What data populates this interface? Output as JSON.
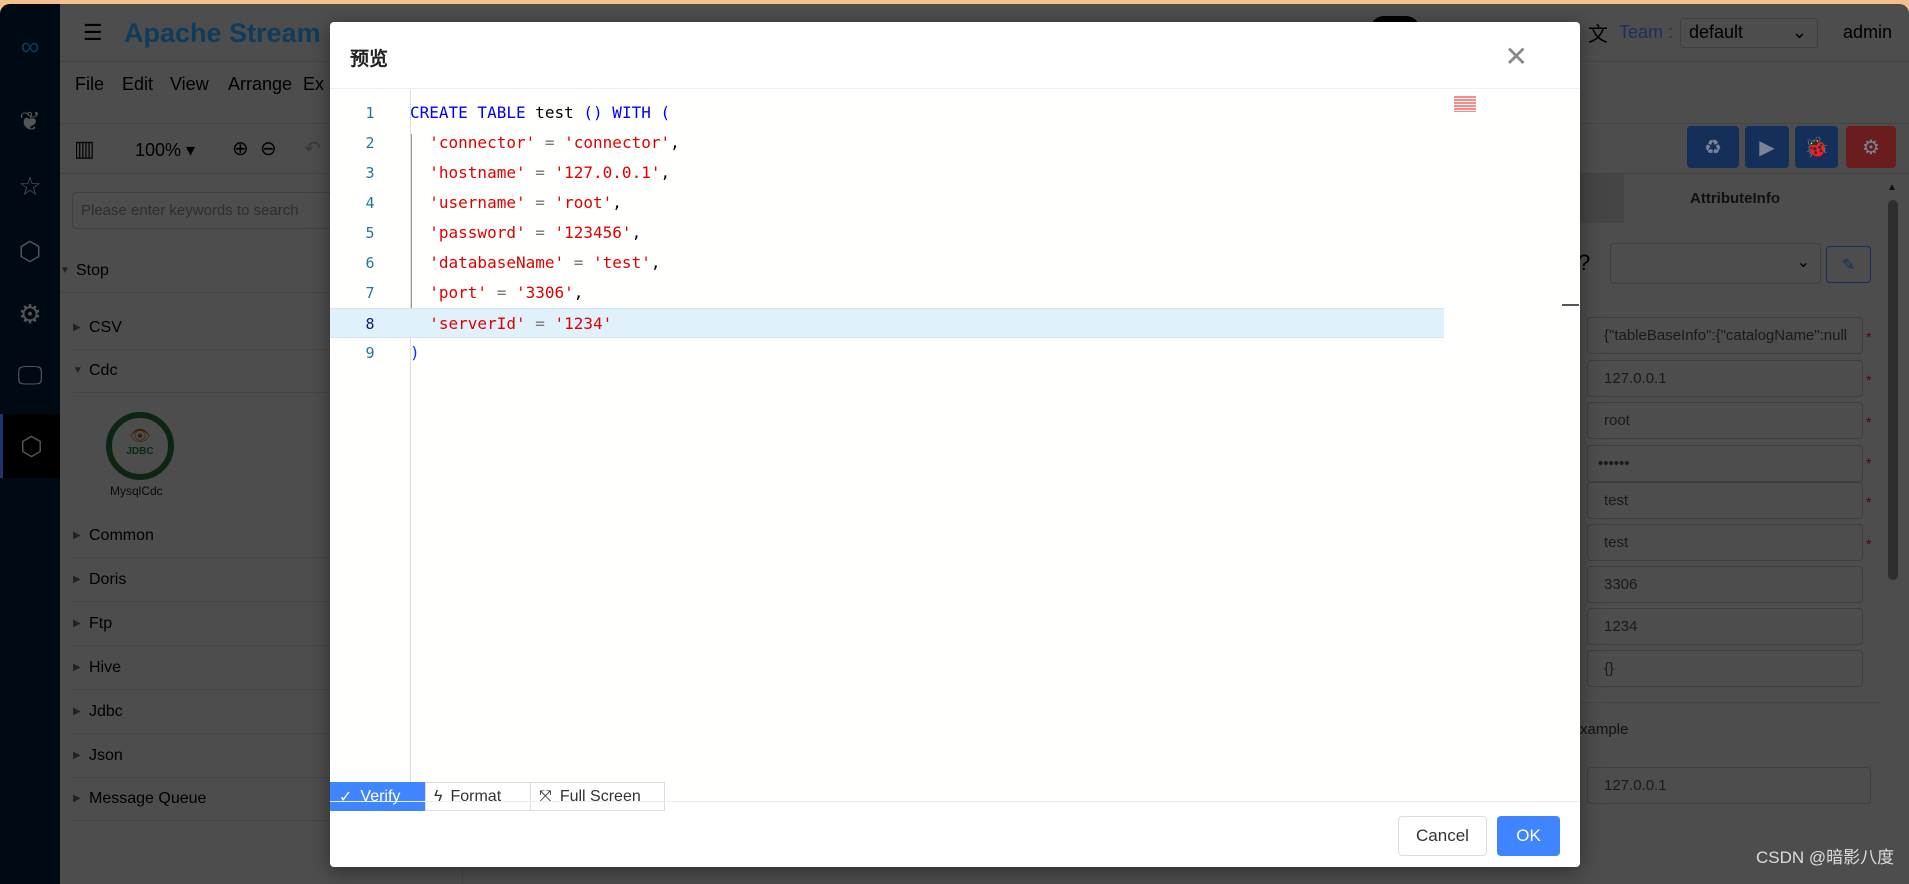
{
  "app": {
    "title": "Apache Stream",
    "team_label": "Team :",
    "team_value": "default",
    "user": "admin"
  },
  "nav": {
    "icons": [
      "logo-icon",
      "squirrel-icon",
      "star-icon",
      "cubes-icon",
      "gear-icon",
      "monitor-icon",
      "cubes-active-icon"
    ]
  },
  "menu": [
    "File",
    "Edit",
    "View",
    "Arrange",
    "Ex"
  ],
  "toolbar": {
    "zoom": "100%"
  },
  "sidebar": {
    "search_placeholder": "Please enter keywords to search",
    "groups": [
      "Stop",
      "CSV",
      "Cdc",
      "Common",
      "Doris",
      "Ftp",
      "Hive",
      "Jdbc",
      "Json",
      "Message Queue"
    ],
    "component": {
      "label": "MysqlCdc",
      "badge": "JDBC"
    }
  },
  "right": {
    "tab": "AttributeInfo",
    "fields": [
      "{\"tableBaseInfo\":{\"catalogName\":null",
      "127.0.0.1",
      "root",
      "••••••",
      "test",
      "test",
      "3306",
      "1234",
      "{}"
    ],
    "required": [
      true,
      true,
      true,
      true,
      true,
      true,
      false,
      false,
      false
    ],
    "example_label": "xample",
    "example_value": "127.0.0.1",
    "colors": {
      "blue": "#1e5bb8",
      "red": "#d93a3a"
    }
  },
  "dialog": {
    "title": "预览",
    "highlighted_line": 8,
    "lines": [
      [
        {
          "t": "CREATE TABLE ",
          "c": "kw"
        },
        {
          "t": "test ",
          "c": "pl"
        },
        {
          "t": "() WITH (",
          "c": "kw"
        }
      ],
      [
        {
          "t": "  'connector'",
          "c": "str"
        },
        {
          "t": " = ",
          "c": "op"
        },
        {
          "t": "'connector'",
          "c": "str"
        },
        {
          "t": ",",
          "c": "pl"
        }
      ],
      [
        {
          "t": "  'hostname'",
          "c": "str"
        },
        {
          "t": " = ",
          "c": "op"
        },
        {
          "t": "'127.0.0.1'",
          "c": "str"
        },
        {
          "t": ",",
          "c": "pl"
        }
      ],
      [
        {
          "t": "  'username'",
          "c": "str"
        },
        {
          "t": " = ",
          "c": "op"
        },
        {
          "t": "'root'",
          "c": "str"
        },
        {
          "t": ",",
          "c": "pl"
        }
      ],
      [
        {
          "t": "  'password'",
          "c": "str"
        },
        {
          "t": " = ",
          "c": "op"
        },
        {
          "t": "'123456'",
          "c": "str"
        },
        {
          "t": ",",
          "c": "pl"
        }
      ],
      [
        {
          "t": "  'databaseName'",
          "c": "str"
        },
        {
          "t": " = ",
          "c": "op"
        },
        {
          "t": "'test'",
          "c": "str"
        },
        {
          "t": ",",
          "c": "pl"
        }
      ],
      [
        {
          "t": "  'port'",
          "c": "str"
        },
        {
          "t": " = ",
          "c": "op"
        },
        {
          "t": "'3306'",
          "c": "str"
        },
        {
          "t": ",",
          "c": "pl"
        }
      ],
      [
        {
          "t": "  'serverId'",
          "c": "str"
        },
        {
          "t": " = ",
          "c": "op"
        },
        {
          "t": "'1234'",
          "c": "str"
        }
      ],
      [
        {
          "t": ")",
          "c": "pn"
        }
      ]
    ],
    "verify": "Verify",
    "format": "Format",
    "fullscreen": "Full Screen",
    "cancel": "Cancel",
    "ok": "OK"
  },
  "watermark": "CSDN @暗影八度"
}
